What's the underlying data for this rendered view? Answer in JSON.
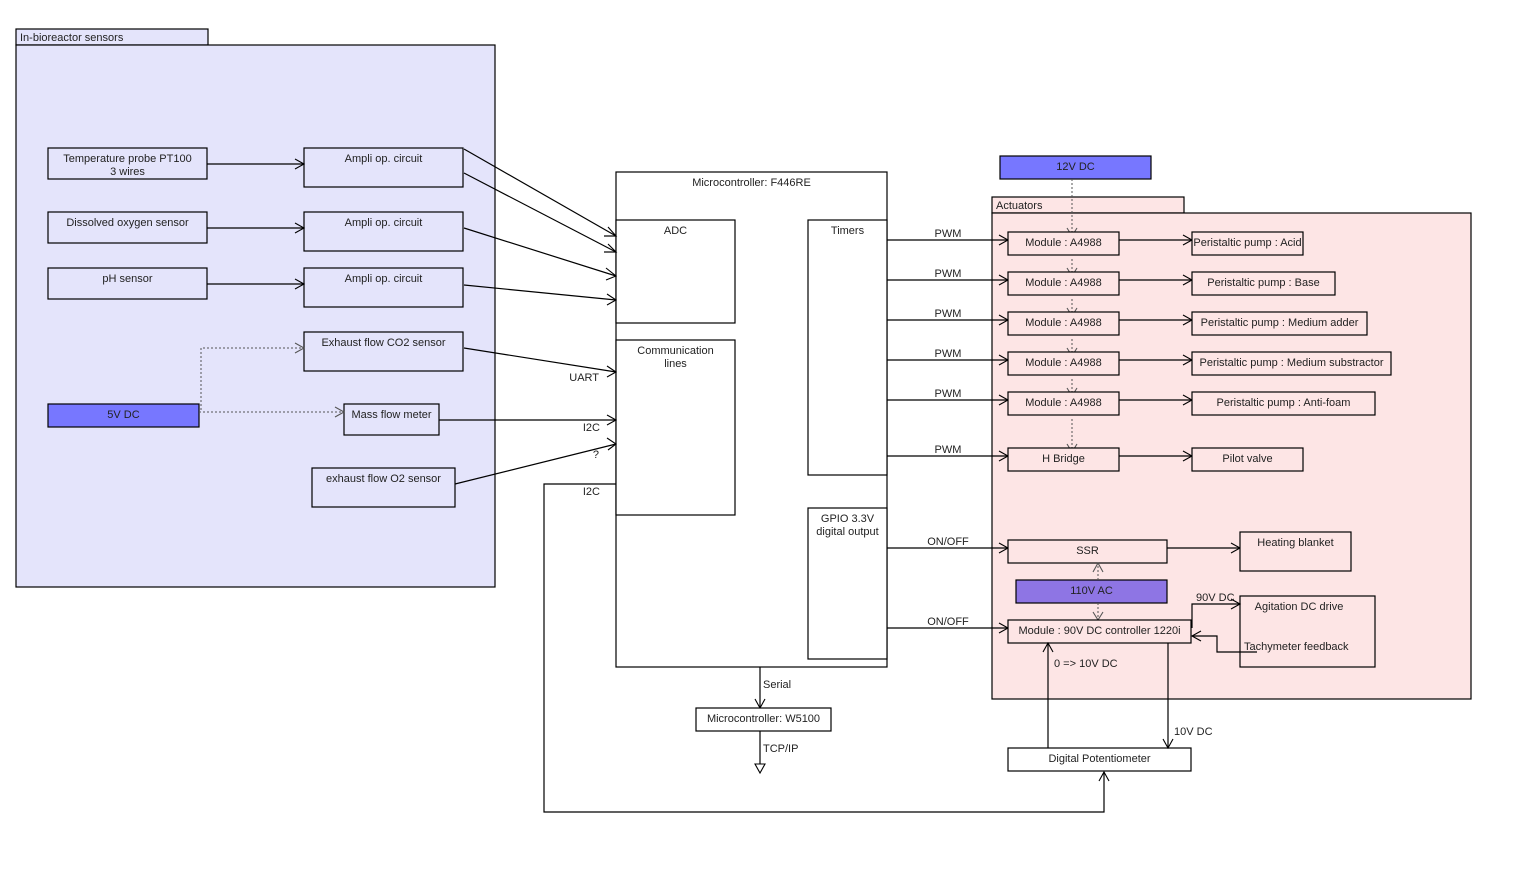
{
  "packages": {
    "sensors": {
      "label": "In-bioreactor sensors",
      "color": "#e4e4fb"
    },
    "actuators": {
      "label": "Actuators",
      "color": "#fde5e5"
    }
  },
  "sensors": {
    "temperature_line1": "Temperature probe PT100",
    "temperature_line2": "3 wires",
    "dissolved_oxygen": "Dissolved oxygen sensor",
    "ph": "pH sensor",
    "ampli_1": "Ampli op. circuit",
    "ampli_2": "Ampli op. circuit",
    "ampli_3": "Ampli op. circuit",
    "co2": "Exhaust flow CO2 sensor",
    "mass_flow": "Mass flow meter",
    "o2": "exhaust flow O2 sensor"
  },
  "power": {
    "v5": {
      "label": "5V DC",
      "color": "#7777ff"
    },
    "v12": {
      "label": "12V DC",
      "color": "#7777ff"
    },
    "v110": {
      "label": "110V AC",
      "color": "#8e75e4"
    }
  },
  "mcu": {
    "title": "Microcontroller: F446RE",
    "adc": "ADC",
    "comm_line1": "Communication",
    "comm_line2": "lines",
    "timers": "Timers",
    "gpio_line1": "GPIO 3.3V",
    "gpio_line2": "digital output"
  },
  "bus_labels": {
    "uart": "UART",
    "i2c_mass": "I2C",
    "unknown": "?",
    "i2c_pot": "I2C",
    "serial": "Serial",
    "tcpip": "TCP/IP",
    "pwm": [
      "PWM",
      "PWM",
      "PWM",
      "PWM",
      "PWM",
      "PWM"
    ],
    "onoff": [
      "ON/OFF",
      "ON/OFF"
    ],
    "v90": "90V DC",
    "v0_10": "0 => 10V DC",
    "v10": "10V DC",
    "tacho": "Tachymeter feedback"
  },
  "ethernet": {
    "label": "Microcontroller: W5100"
  },
  "actuators": {
    "drivers": [
      "Module : A4988",
      "Module : A4988",
      "Module : A4988",
      "Module : A4988",
      "Module : A4988",
      "H Bridge"
    ],
    "targets": [
      "Peristaltic pump : Acid",
      "Peristaltic pump : Base",
      "Peristaltic pump : Medium adder",
      "Peristaltic pump : Medium substractor",
      "Peristaltic pump : Anti-foam",
      "Pilot valve"
    ],
    "ssr": "SSR",
    "heating": "Heating blanket",
    "dc_controller": "Module : 90V DC controller 1220i",
    "agitation": "Agitation DC drive"
  },
  "potentiometer": {
    "label": "Digital Potentiometer"
  }
}
